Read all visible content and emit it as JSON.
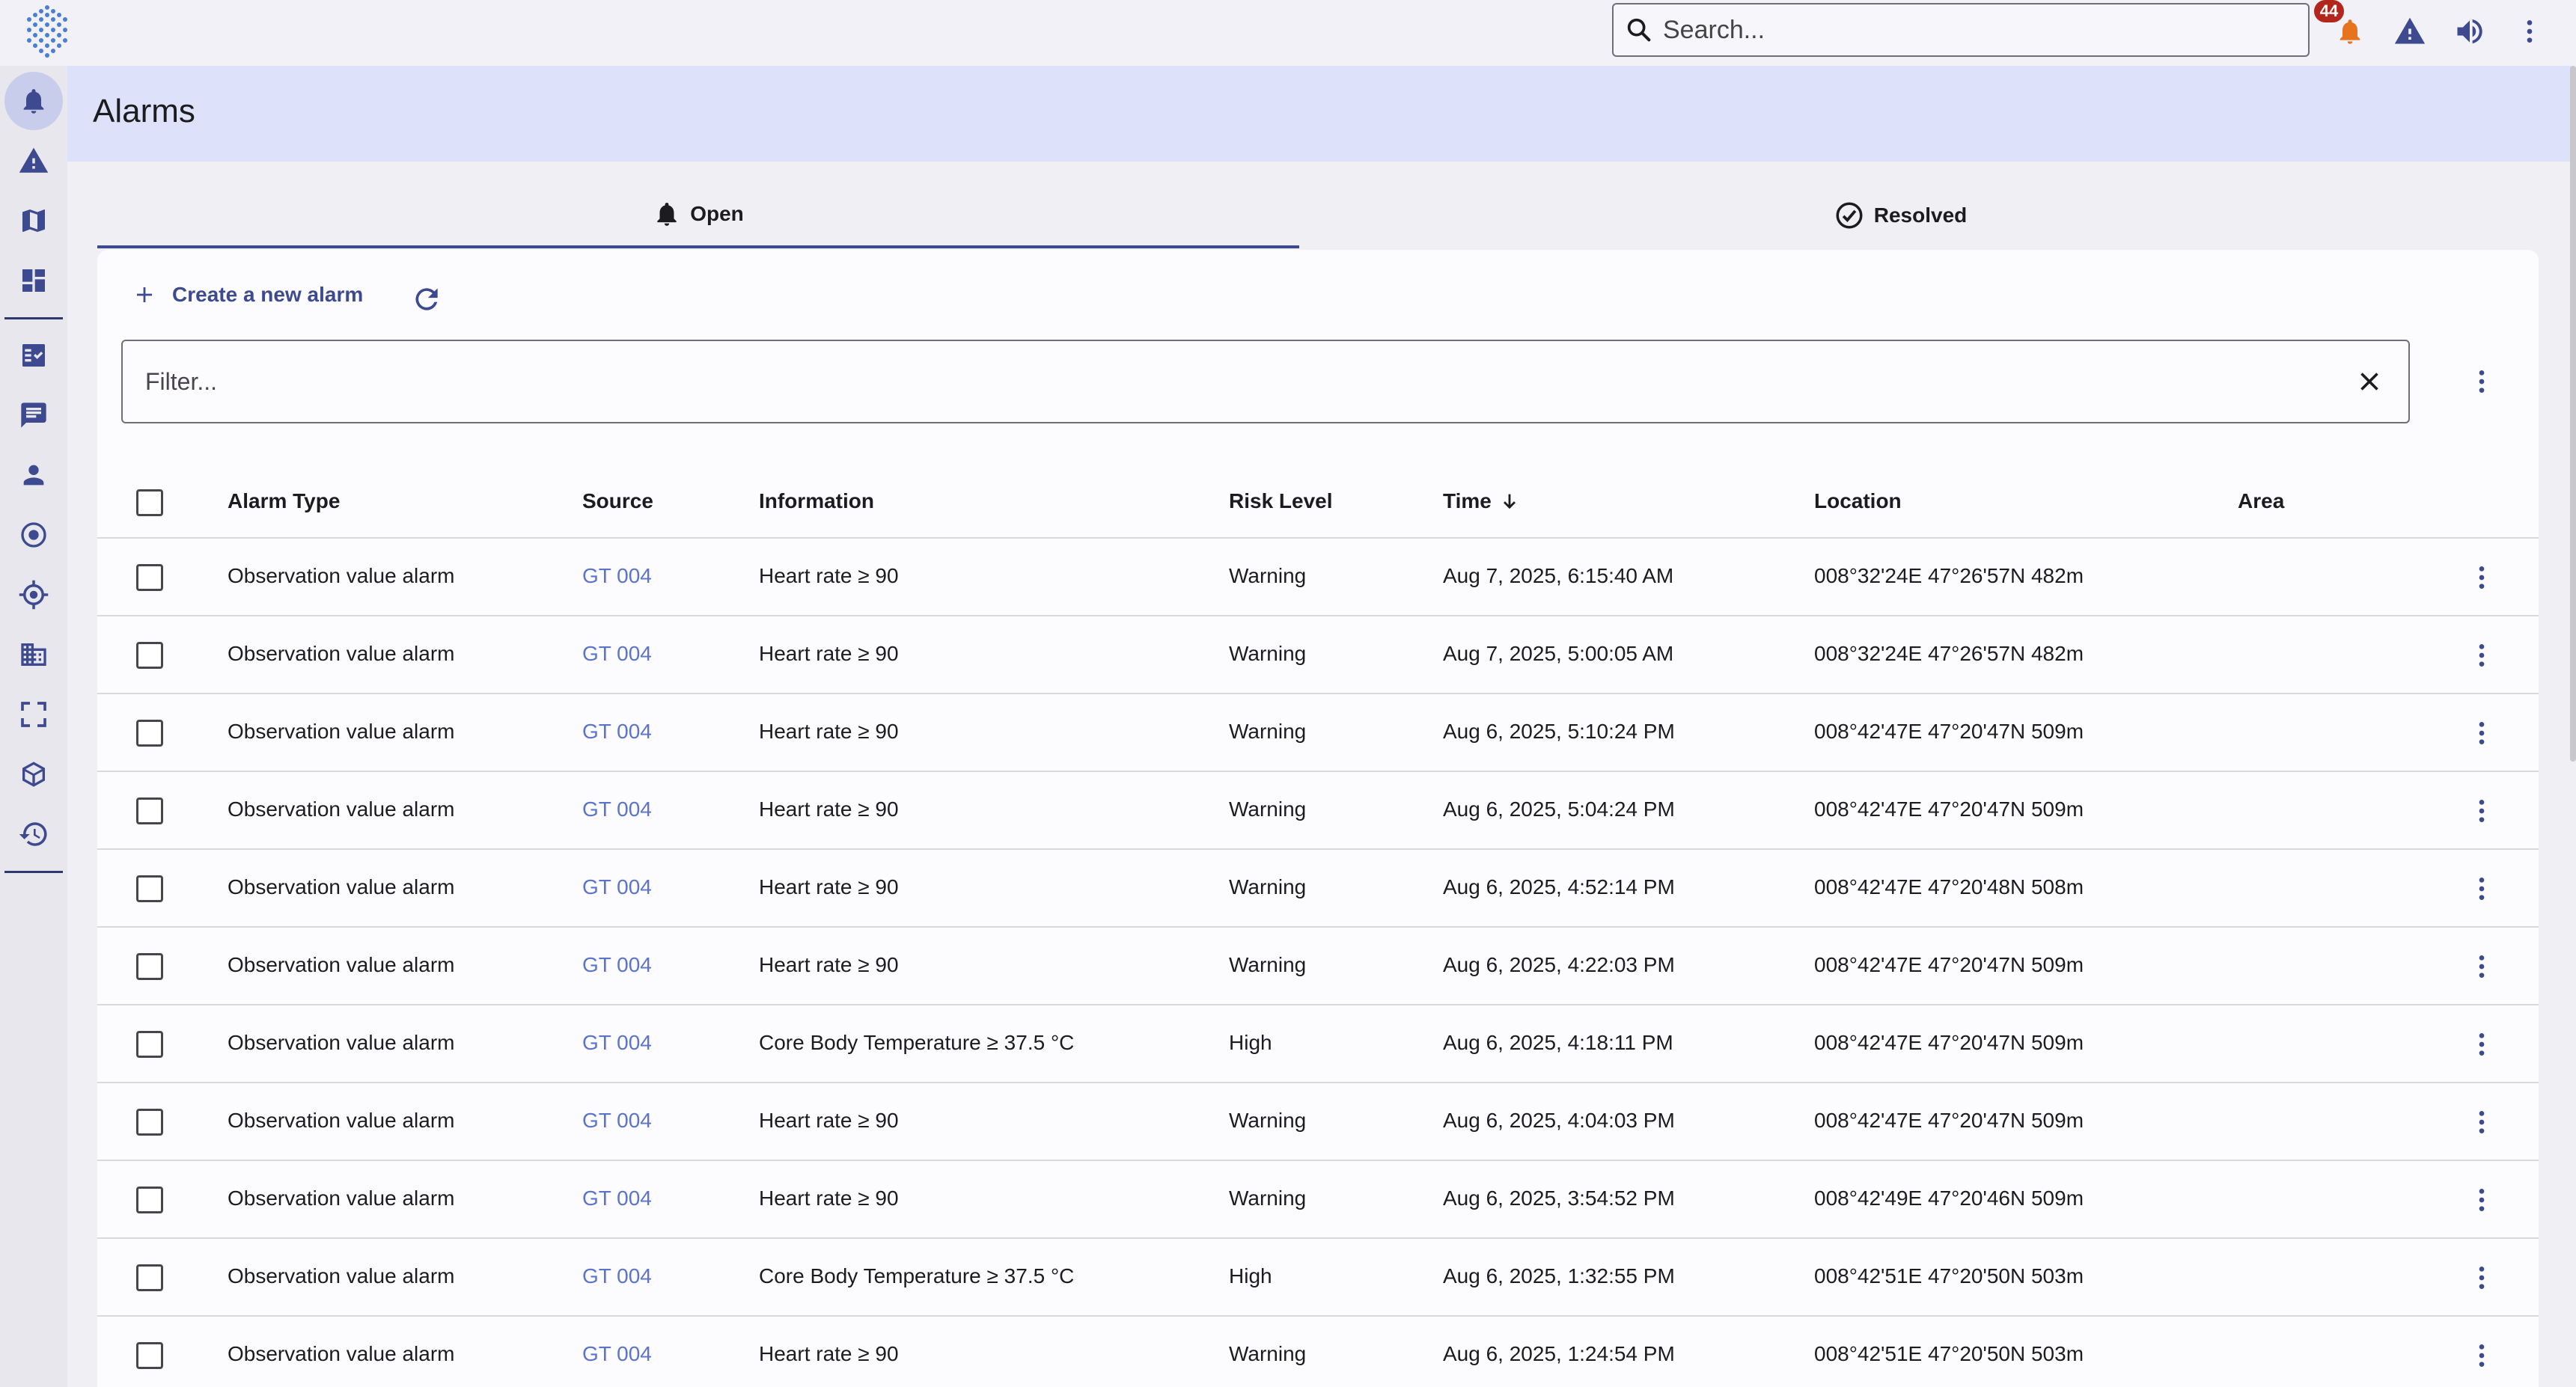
{
  "search": {
    "placeholder": "Search..."
  },
  "notifications": {
    "count": "44"
  },
  "page": {
    "title": "Alarms"
  },
  "tabs": [
    {
      "label": "Open",
      "icon": "bell-icon",
      "selected": true
    },
    {
      "label": "Resolved",
      "icon": "check-circle-icon",
      "selected": false
    }
  ],
  "toolbar": {
    "create_label": "Create a new alarm"
  },
  "filter": {
    "placeholder": "Filter..."
  },
  "table": {
    "columns": [
      "Alarm Type",
      "Source",
      "Information",
      "Risk Level",
      "Time",
      "Location",
      "Area"
    ],
    "sort_column": "Time",
    "rows": [
      {
        "type": "Observation value alarm",
        "source": "GT 004",
        "info": "Heart rate ≥ 90",
        "risk": "Warning",
        "time": "Aug 7, 2025, 6:15:40 AM",
        "location": "008°32'24E 47°26'57N 482m",
        "area": ""
      },
      {
        "type": "Observation value alarm",
        "source": "GT 004",
        "info": "Heart rate ≥ 90",
        "risk": "Warning",
        "time": "Aug 7, 2025, 5:00:05 AM",
        "location": "008°32'24E 47°26'57N 482m",
        "area": ""
      },
      {
        "type": "Observation value alarm",
        "source": "GT 004",
        "info": "Heart rate ≥ 90",
        "risk": "Warning",
        "time": "Aug 6, 2025, 5:10:24 PM",
        "location": "008°42'47E 47°20'47N 509m",
        "area": ""
      },
      {
        "type": "Observation value alarm",
        "source": "GT 004",
        "info": "Heart rate ≥ 90",
        "risk": "Warning",
        "time": "Aug 6, 2025, 5:04:24 PM",
        "location": "008°42'47E 47°20'47N 509m",
        "area": ""
      },
      {
        "type": "Observation value alarm",
        "source": "GT 004",
        "info": "Heart rate ≥ 90",
        "risk": "Warning",
        "time": "Aug 6, 2025, 4:52:14 PM",
        "location": "008°42'47E 47°20'48N 508m",
        "area": ""
      },
      {
        "type": "Observation value alarm",
        "source": "GT 004",
        "info": "Heart rate ≥ 90",
        "risk": "Warning",
        "time": "Aug 6, 2025, 4:22:03 PM",
        "location": "008°42'47E 47°20'47N 509m",
        "area": ""
      },
      {
        "type": "Observation value alarm",
        "source": "GT 004",
        "info": "Core Body Temperature ≥ 37.5  °C",
        "risk": "High",
        "time": "Aug 6, 2025, 4:18:11 PM",
        "location": "008°42'47E 47°20'47N 509m",
        "area": ""
      },
      {
        "type": "Observation value alarm",
        "source": "GT 004",
        "info": "Heart rate ≥ 90",
        "risk": "Warning",
        "time": "Aug 6, 2025, 4:04:03 PM",
        "location": "008°42'47E 47°20'47N 509m",
        "area": ""
      },
      {
        "type": "Observation value alarm",
        "source": "GT 004",
        "info": "Heart rate ≥ 90",
        "risk": "Warning",
        "time": "Aug 6, 2025, 3:54:52 PM",
        "location": "008°42'49E 47°20'46N 509m",
        "area": ""
      },
      {
        "type": "Observation value alarm",
        "source": "GT 004",
        "info": "Core Body Temperature ≥ 37.5  °C",
        "risk": "High",
        "time": "Aug 6, 2025, 1:32:55 PM",
        "location": "008°42'51E 47°20'50N 503m",
        "area": ""
      },
      {
        "type": "Observation value alarm",
        "source": "GT 004",
        "info": "Heart rate ≥ 90",
        "risk": "Warning",
        "time": "Aug 6, 2025, 1:24:54 PM",
        "location": "008°42'51E 47°20'50N 503m",
        "area": ""
      }
    ]
  },
  "sidebar": {
    "items": [
      {
        "icon": "bell-icon",
        "active": true
      },
      {
        "icon": "warning-icon"
      },
      {
        "icon": "map-icon"
      },
      {
        "icon": "dashboard-icon"
      },
      {
        "icon": "task-list-icon"
      },
      {
        "icon": "chat-icon"
      },
      {
        "icon": "person-icon"
      },
      {
        "icon": "target-icon"
      },
      {
        "icon": "gps-icon"
      },
      {
        "icon": "building-icon"
      },
      {
        "icon": "fullscreen-icon"
      },
      {
        "icon": "cube-icon"
      },
      {
        "icon": "history-icon"
      }
    ]
  },
  "colors": {
    "accent": "#3d4a8f",
    "link": "#5b73c9",
    "header_bg": "#dde1f9",
    "badge": "#b3261e"
  }
}
